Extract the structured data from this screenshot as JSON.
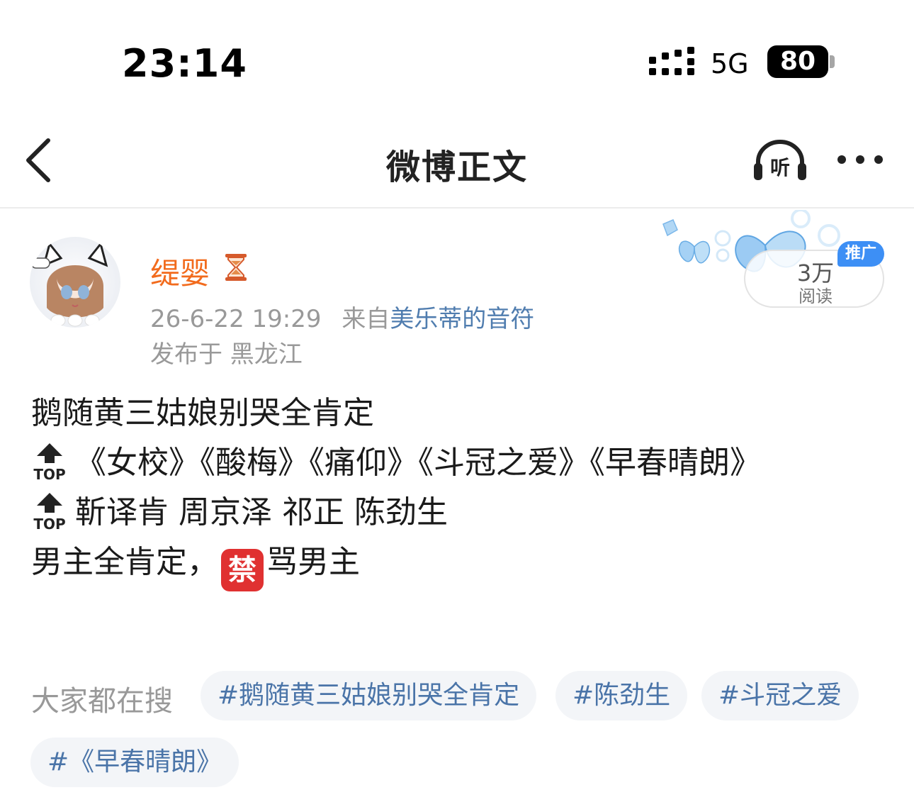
{
  "status_bar": {
    "time": "23:14",
    "network": "5G",
    "battery": "80"
  },
  "nav": {
    "title": "微博正文",
    "listen_label": "听",
    "back_icon": "chevron-left-icon",
    "more_icon": "ellipsis-icon"
  },
  "post": {
    "author": {
      "name": "缇婴",
      "badge_icon": "hourglass-icon"
    },
    "timestamp": "26-6-22 19:29",
    "source_prefix": "来自",
    "source": "美乐蒂的音符",
    "location": "发布于 黑龙江",
    "read_count": "3万",
    "read_label": "阅读",
    "promo_badge": "推广",
    "lines": {
      "line1": "鹅随黄三姑娘别哭全肯定",
      "line2": "《女校》《酸梅》《痛仰》《斗冠之爱》《早春晴朗》",
      "line3": "靳译肯 周京泽 祁正 陈劲生",
      "line4a": "男主全肯定，",
      "ban_glyph": "禁",
      "line4b": "骂男主"
    },
    "top_icon_label": "TOP"
  },
  "trending": {
    "label": "大家都在搜",
    "chips": [
      "#鹅随黄三姑娘别哭全肯定",
      "#陈劲生",
      "#斗冠之爱",
      "#《早春晴朗》"
    ]
  },
  "colors": {
    "username": "#f26b1d",
    "link": "#507daf",
    "chip_text": "#4a74a8",
    "chip_bg": "#f3f5f8",
    "promo": "#3d8ff5",
    "ban": "#e03131"
  }
}
